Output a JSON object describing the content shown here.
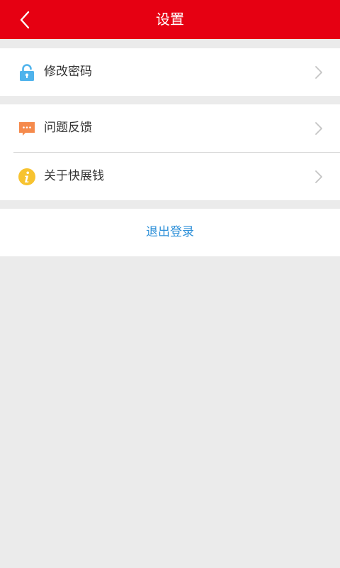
{
  "header": {
    "title": "设置",
    "background": "#e60012",
    "back_icon": "back-arrow-icon"
  },
  "groups": [
    {
      "items": [
        {
          "label": "修改密码",
          "icon": "lock-icon",
          "icon_color": "#4fb3ec"
        }
      ]
    },
    {
      "items": [
        {
          "label": "问题反馈",
          "icon": "feedback-icon",
          "icon_color": "#f58a4c"
        },
        {
          "label": "关于快展钱",
          "icon": "info-icon",
          "icon_color": "#f7c330"
        }
      ]
    }
  ],
  "logout": {
    "label": "退出登录",
    "color": "#2c8fd8"
  },
  "chevron_icon": "chevron-right-icon",
  "page_background": "#ebebeb"
}
